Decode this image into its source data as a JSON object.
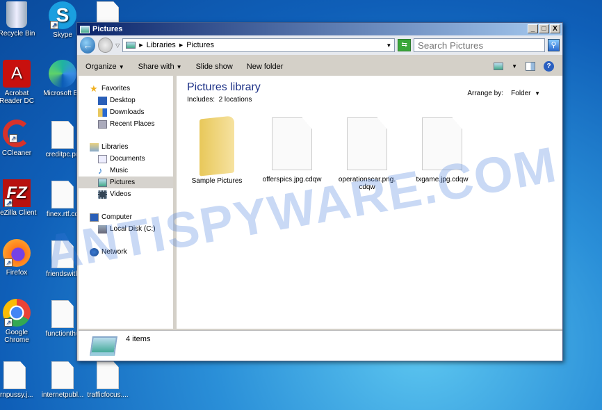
{
  "desktop": {
    "icons": [
      {
        "label": "Recycle Bin"
      },
      {
        "label": "Skype"
      },
      {
        "label": "Acrobat Reader DC"
      },
      {
        "label": "Microsoft Ed"
      },
      {
        "label": "CCleaner"
      },
      {
        "label": "creditpc.pn"
      },
      {
        "label": "ileZilla Client"
      },
      {
        "label": "finex.rtf.cd"
      },
      {
        "label": "Firefox"
      },
      {
        "label": "friendswith"
      },
      {
        "label": "Google Chrome"
      },
      {
        "label": "functionthu"
      },
      {
        "label": "ornpussy.j..."
      },
      {
        "label": "internetpubl..."
      },
      {
        "label": "trafficfocus...."
      }
    ]
  },
  "window": {
    "title": "Pictures",
    "minimize": "_",
    "maximize": "□",
    "close": "X"
  },
  "address": {
    "crumbs": [
      "Libraries",
      "Pictures"
    ],
    "search_placeholder": "Search Pictures"
  },
  "toolbar": {
    "organize": "Organize",
    "share_with": "Share with",
    "slide_show": "Slide show",
    "new_folder": "New folder"
  },
  "nav": {
    "favorites": "Favorites",
    "desktop": "Desktop",
    "downloads": "Downloads",
    "recent": "Recent Places",
    "libraries": "Libraries",
    "documents": "Documents",
    "music": "Music",
    "pictures": "Pictures",
    "videos": "Videos",
    "computer": "Computer",
    "local_disk": "Local Disk (C:)",
    "network": "Network"
  },
  "content": {
    "title": "Pictures library",
    "includes_label": "Includes:",
    "includes_value": "2 locations",
    "arrange_label": "Arrange by:",
    "arrange_value": "Folder",
    "items": [
      {
        "name": "Sample Pictures",
        "type": "folder"
      },
      {
        "name": "offerspics.jpg.cdqw",
        "type": "file"
      },
      {
        "name": "operationscar.png.cdqw",
        "type": "file"
      },
      {
        "name": "txgame.jpg.cdqw",
        "type": "file"
      }
    ]
  },
  "status": {
    "count": "4 items"
  },
  "watermark": "ANTISPYWARE.COM"
}
